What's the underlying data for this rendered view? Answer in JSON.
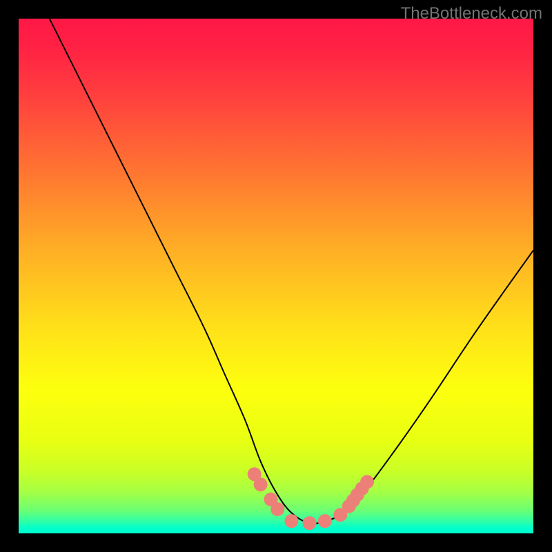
{
  "attribution": "TheBottleneck.com",
  "chart_data": {
    "type": "line",
    "title": "",
    "xlabel": "",
    "ylabel": "",
    "xlim": [
      0,
      100
    ],
    "ylim": [
      0,
      100
    ],
    "gradient_stops": [
      {
        "offset": 0.0,
        "color": "#ff1846"
      },
      {
        "offset": 0.05,
        "color": "#ff2044"
      },
      {
        "offset": 0.15,
        "color": "#ff3f3e"
      },
      {
        "offset": 0.3,
        "color": "#ff7631"
      },
      {
        "offset": 0.45,
        "color": "#ffaf25"
      },
      {
        "offset": 0.6,
        "color": "#ffe019"
      },
      {
        "offset": 0.72,
        "color": "#fdff0e"
      },
      {
        "offset": 0.82,
        "color": "#e8ff12"
      },
      {
        "offset": 0.88,
        "color": "#c9ff27"
      },
      {
        "offset": 0.92,
        "color": "#a4ff45"
      },
      {
        "offset": 0.955,
        "color": "#6cff73"
      },
      {
        "offset": 0.975,
        "color": "#34ffa3"
      },
      {
        "offset": 0.99,
        "color": "#01ffcc"
      },
      {
        "offset": 1.0,
        "color": "#00ffd0"
      }
    ],
    "series": [
      {
        "name": "bottleneck-curve",
        "x": [
          6,
          12,
          18,
          24,
          30,
          36,
          40,
          44,
          47,
          50,
          53,
          56.5,
          60,
          63,
          67,
          73,
          80,
          88,
          95,
          100
        ],
        "y": [
          100,
          88,
          76,
          64,
          52,
          40,
          31,
          22,
          14,
          8,
          4,
          2,
          2.5,
          4,
          8,
          16,
          26,
          38,
          48,
          55
        ]
      }
    ],
    "markers": [
      {
        "name": "left-cluster-1",
        "x": 45.8,
        "y": 11.5
      },
      {
        "name": "left-cluster-2",
        "x": 47.0,
        "y": 9.5
      },
      {
        "name": "left-cluster-3",
        "x": 49.0,
        "y": 6.6
      },
      {
        "name": "left-cluster-4",
        "x": 50.3,
        "y": 4.7
      },
      {
        "name": "bottom-cap-left",
        "x": 53.0,
        "y": 2.4
      },
      {
        "name": "bottom-cap-mid",
        "x": 56.5,
        "y": 2.0
      },
      {
        "name": "bottom-cap-right",
        "x": 59.5,
        "y": 2.4
      },
      {
        "name": "right-single",
        "x": 62.5,
        "y": 3.6
      },
      {
        "name": "right-cluster-1",
        "x": 64.2,
        "y": 5.3
      },
      {
        "name": "right-cluster-2",
        "x": 65.0,
        "y": 6.4
      },
      {
        "name": "right-cluster-3",
        "x": 65.8,
        "y": 7.5
      },
      {
        "name": "right-cluster-4",
        "x": 66.7,
        "y": 8.7
      },
      {
        "name": "right-cluster-5",
        "x": 67.7,
        "y": 10.0
      }
    ],
    "marker_style": {
      "radius": 10,
      "fill": "#ec8079"
    }
  }
}
